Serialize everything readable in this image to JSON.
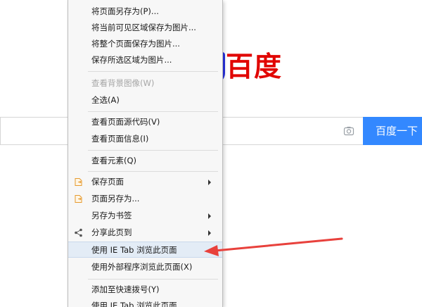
{
  "page": {
    "logo_text": "百度",
    "search_button_label": "百度一下"
  },
  "context_menu": {
    "items": [
      {
        "label": "将页面另存为(P)..."
      },
      {
        "label": "将当前可见区域保存为图片..."
      },
      {
        "label": "将整个页面保存为图片..."
      },
      {
        "label": "保存所选区域为图片..."
      },
      {
        "label": "查看背景图像(W)"
      },
      {
        "label": "全选(A)"
      },
      {
        "label": "查看页面源代码(V)"
      },
      {
        "label": "查看页面信息(I)"
      },
      {
        "label": "查看元素(Q)"
      },
      {
        "label": "保存页面"
      },
      {
        "label": "页面另存为..."
      },
      {
        "label": "另存为书签"
      },
      {
        "label": "分享此页到"
      },
      {
        "label": "使用 IE Tab 浏览此页面"
      },
      {
        "label": "使用外部程序浏览此页面(X)"
      },
      {
        "label": "添加至快速拨号(Y)"
      },
      {
        "label": "使用 IE Tab 浏览此页面"
      }
    ]
  },
  "colors": {
    "logo_red": "#e10602",
    "logo_blue": "#2932e1",
    "search_button_blue": "#3388ff",
    "highlight": "#e3ecf6",
    "annotation_arrow": "#e8413c"
  }
}
